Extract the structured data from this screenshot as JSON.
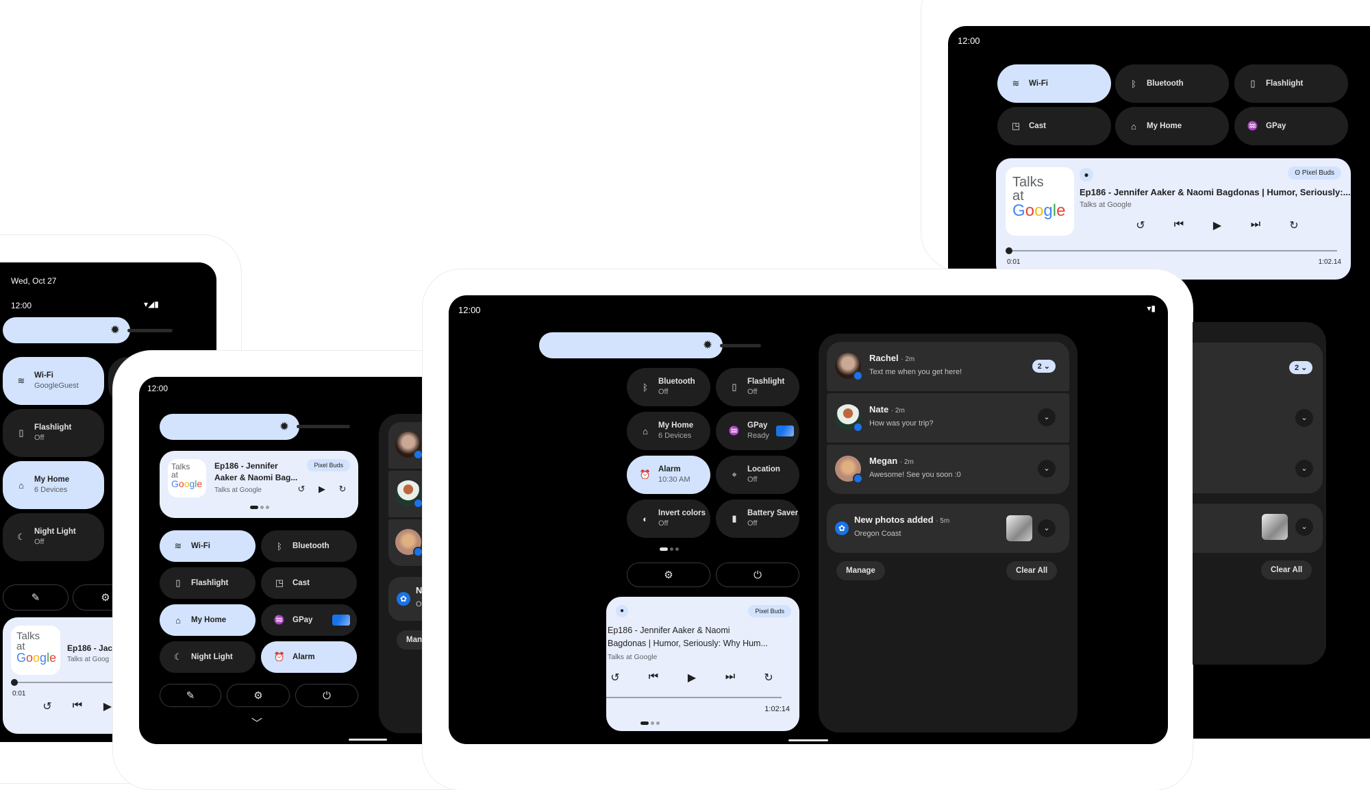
{
  "status": {
    "time": "12:00",
    "date": "Wed, Oct 27"
  },
  "icons": {
    "wifi": "wifi-icon",
    "signal": "signal-icon",
    "battery": "battery-icon",
    "brightness": "brightness-icon"
  },
  "tiles": {
    "wifi": "Wi-Fi",
    "wifi_sub": "GoogleGuest",
    "bluetooth": "Bluetooth",
    "flashlight": "Flashlight",
    "cast": "Cast",
    "my_home": "My Home",
    "my_home_sub": "6 Devices",
    "gpay": "GPay",
    "gpay_sub": "Ready",
    "night_light": "Night Light",
    "alarm": "Alarm",
    "alarm_sub": "10:30 AM",
    "location": "Location",
    "invert": "Invert colors",
    "battery_saver": "Battery Saver",
    "off": "Off"
  },
  "media": {
    "art_line1": "Talks",
    "art_line2": "at",
    "art_google": [
      "G",
      "o",
      "o",
      "g",
      "l",
      "e"
    ],
    "title_full": "Ep186 - Jennifer Aaker & Naomi Bagdonas | Humor, Seriously:...",
    "title_two_line_a": "Ep186 - Jennifer",
    "title_two_line_b": "Aaker & Naomi Bag...",
    "title_wrap_a": "Ep186 - Jennifer Aaker & Naomi",
    "title_wrap_b": "Bagdonas | Humor, Seriously: Why Hum...",
    "title_short": "Ep186 - Jac",
    "artist": "Talks at Google",
    "artist_short": "Talks at Goog",
    "output": "Pixel Buds",
    "elapsed": "0:01",
    "duration": "1:02.14",
    "duration_alt": "1:02:14",
    "progress_fraction": 0.0003
  },
  "controls": {
    "replay": "replay-15-icon",
    "prev": "⏮",
    "play": "▶",
    "next": "⏭",
    "forward": "forward-15-icon",
    "edit": "✎",
    "settings": "⚙",
    "power": "⏻",
    "chevron": "⌄"
  },
  "notifications": [
    {
      "name": "Rachel",
      "time": "2m",
      "text": "Text me when you get here!",
      "count": "2"
    },
    {
      "name": "Nate",
      "time": "2m",
      "text": "How was your trip?"
    },
    {
      "name": "Megan",
      "time": "2m",
      "text": "Awesome! See you soon :0"
    },
    {
      "name": "New photos added",
      "time": "5m",
      "text": "Oregon Coast"
    }
  ],
  "actions": {
    "manage": "Manage",
    "clear_all": "Clear All"
  },
  "colors": {
    "tile_on": "#d3e3fd",
    "tile_off": "#1f1f1f",
    "media_bg": "#e8eefc",
    "accent": "#1a73e8"
  }
}
